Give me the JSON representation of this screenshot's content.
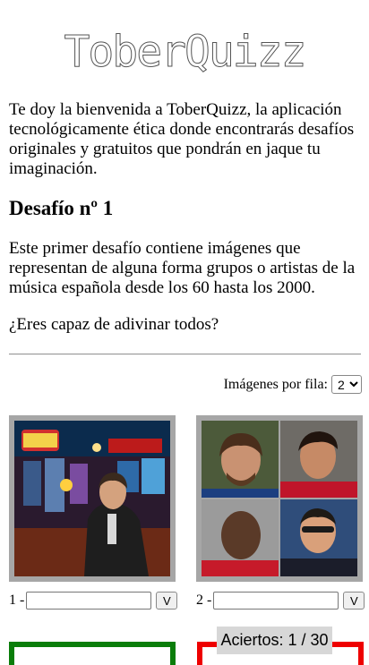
{
  "logo": {
    "text": "ToberQuizz"
  },
  "intro": "Te doy la bienvenida a ToberQuizz, la aplicación tecnológicamente ética donde encontrarás desafíos originales y gratuitos que pondrán en jaque tu imaginación.",
  "challenge": {
    "title": "Desafío nº 1",
    "description": "Este primer desafío contiene imágenes que representan de alguna forma grupos o artistas de la música española desde los 60 hasta los 2000.",
    "question": "¿Eres capaz de adivinar todos?"
  },
  "images_per_row": {
    "label": "Imágenes por fila:",
    "selected": "2"
  },
  "cards": [
    {
      "number_label": "1 -",
      "input_value": "",
      "submit_label": "V",
      "status": "pending"
    },
    {
      "number_label": "2 -",
      "input_value": "",
      "submit_label": "V",
      "status": "pending"
    },
    {
      "status": "correct"
    },
    {
      "status": "incorrect"
    }
  ],
  "score": {
    "text": "Aciertos: 1 / 30"
  },
  "colors": {
    "correct": "#0a7d0a",
    "incorrect": "#e00000",
    "card_frame": "#a6a6a6"
  }
}
